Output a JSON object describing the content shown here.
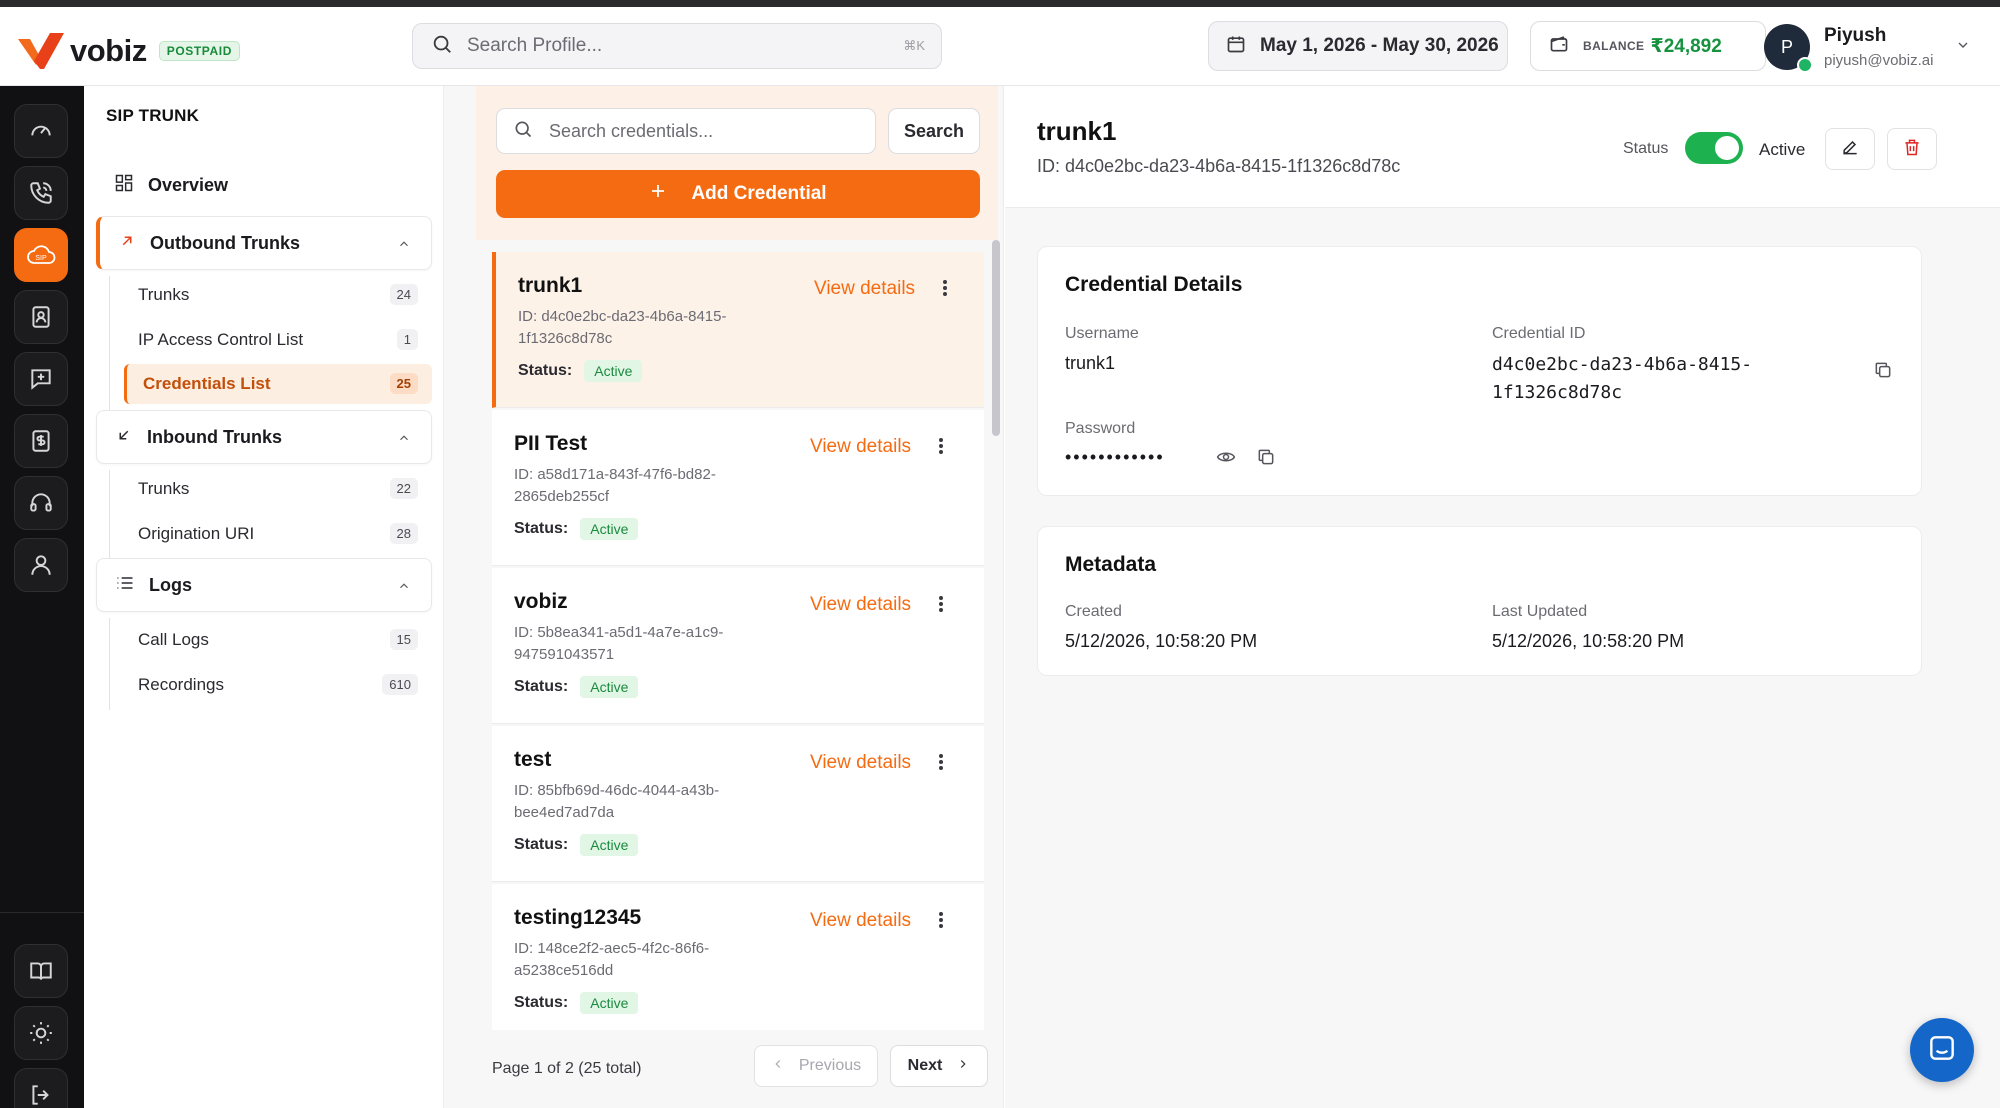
{
  "header": {
    "brand": "vobiz",
    "plan_badge": "POSTPAID",
    "search_placeholder": "Search Profile...",
    "search_shortcut": "⌘K",
    "date_range": "May 1, 2026 - May 30, 2026",
    "balance_label": "BALANCE",
    "balance_amount": "₹24,892",
    "user": {
      "initial": "P",
      "name": "Piyush",
      "email": "piyush@vobiz.ai"
    }
  },
  "rail": {
    "items": [
      "dashboard-icon",
      "phone-icon",
      "sip-cloud-icon",
      "contacts-icon",
      "message-icon",
      "billing-icon",
      "support-icon",
      "user-icon"
    ],
    "bottom_items": [
      "docs-book-icon",
      "theme-sun-icon",
      "logout-icon"
    ]
  },
  "sidebar": {
    "title": "SIP TRUNK",
    "overview": "Overview",
    "outbound": {
      "label": "Outbound Trunks",
      "items": [
        {
          "label": "Trunks",
          "count": "24"
        },
        {
          "label": "IP Access Control List",
          "count": "1"
        },
        {
          "label": "Credentials List",
          "count": "25"
        }
      ]
    },
    "inbound": {
      "label": "Inbound Trunks",
      "items": [
        {
          "label": "Trunks",
          "count": "22"
        },
        {
          "label": "Origination URI",
          "count": "28"
        }
      ]
    },
    "logs": {
      "label": "Logs",
      "items": [
        {
          "label": "Call Logs",
          "count": "15"
        },
        {
          "label": "Recordings",
          "count": "610"
        }
      ]
    }
  },
  "list": {
    "search_placeholder": "Search credentials...",
    "search_button": "Search",
    "add_button": "Add Credential",
    "view_label": "View details",
    "status_label": "Status:",
    "items": [
      {
        "name": "trunk1",
        "id": "ID: d4c0e2bc-da23-4b6a-8415-1f1326c8d78c",
        "status": "Active"
      },
      {
        "name": "PII Test",
        "id": "ID: a58d171a-843f-47f6-bd82-2865deb255cf",
        "status": "Active"
      },
      {
        "name": "vobiz",
        "id": "ID: 5b8ea341-a5d1-4a7e-a1c9-947591043571",
        "status": "Active"
      },
      {
        "name": "test",
        "id": "ID: 85bfb69d-46dc-4044-a43b-bee4ed7ad7da",
        "status": "Active"
      },
      {
        "name": "testing12345",
        "id": "ID: 148ce2f2-aec5-4f2c-86f6-a5238ce516dd",
        "status": "Active"
      }
    ],
    "page_info": "Page 1 of 2 (25 total)",
    "prev_label": "Previous",
    "next_label": "Next"
  },
  "detail": {
    "title": "trunk1",
    "id": "ID: d4c0e2bc-da23-4b6a-8415-1f1326c8d78c",
    "status_label": "Status",
    "status_value": "Active",
    "credential_card": {
      "title": "Credential Details",
      "username_label": "Username",
      "username": "trunk1",
      "credential_id_label": "Credential ID",
      "credential_id_line1": "d4c0e2bc-da23-4b6a-8415-",
      "credential_id_line2": "1f1326c8d78c",
      "password_label": "Password",
      "password_masked": "••••••••••••"
    },
    "metadata_card": {
      "title": "Metadata",
      "created_label": "Created",
      "created": "5/12/2026, 10:58:20 PM",
      "updated_label": "Last Updated",
      "updated": "5/12/2026, 10:58:20 PM"
    }
  },
  "colors": {
    "accent": "#f56b12",
    "success": "#1eb14f",
    "balance": "#17923f",
    "chat": "#1467c9",
    "rail": "#111113"
  }
}
